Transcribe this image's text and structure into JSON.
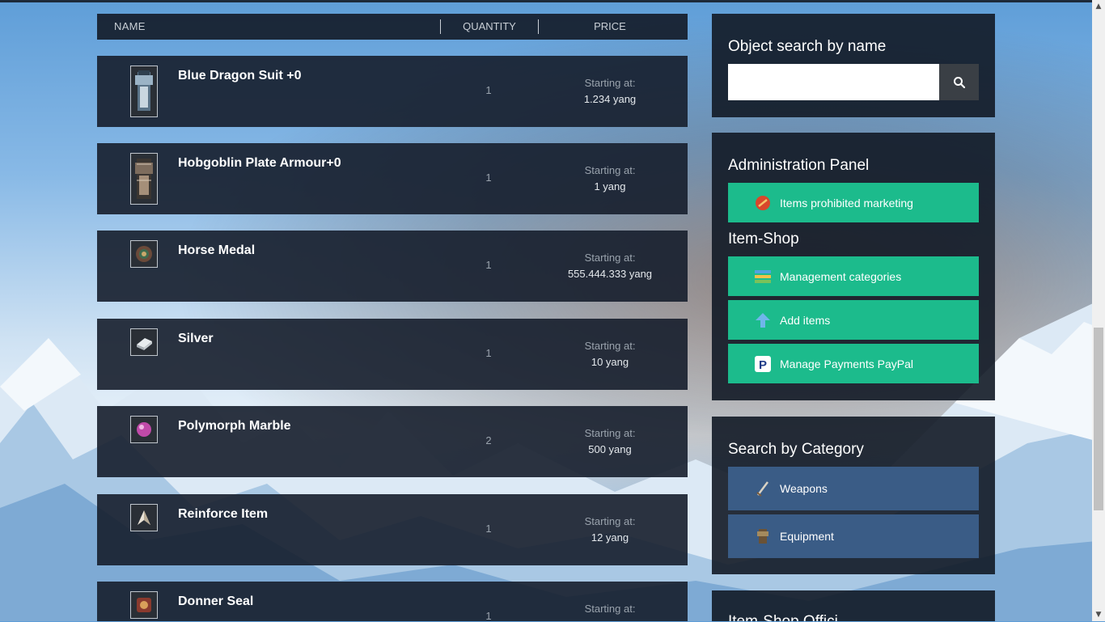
{
  "list_header": {
    "name": "NAME",
    "quantity": "QUANTITY",
    "price": "PRICE"
  },
  "items": [
    {
      "name": "Blue Dragon Suit +0",
      "quantity": "1",
      "price_label": "Starting at:",
      "price": "1.234 yang",
      "icon": "armor-suit-icon"
    },
    {
      "name": "Hobgoblin Plate Armour+0",
      "quantity": "1",
      "price_label": "Starting at:",
      "price": "1 yang",
      "icon": "plate-armor-icon"
    },
    {
      "name": "Horse Medal",
      "quantity": "1",
      "price_label": "Starting at:",
      "price": "555.444.333 yang",
      "icon": "medal-icon"
    },
    {
      "name": "Silver",
      "quantity": "1",
      "price_label": "Starting at:",
      "price": "10 yang",
      "icon": "silver-ingot-icon"
    },
    {
      "name": "Polymorph Marble",
      "quantity": "2",
      "price_label": "Starting at:",
      "price": "500 yang",
      "icon": "marble-icon"
    },
    {
      "name": "Reinforce Item",
      "quantity": "1",
      "price_label": "Starting at:",
      "price": "12 yang",
      "icon": "reinforce-icon"
    },
    {
      "name": "Donner Seal",
      "quantity": "1",
      "price_label": "Starting at:",
      "price": "",
      "icon": "seal-icon"
    }
  ],
  "search": {
    "title": "Object search by name",
    "placeholder": ""
  },
  "admin": {
    "title": "Administration Panel",
    "prohibited_label": "Items prohibited marketing",
    "itemshop_title": "Item-Shop",
    "management_label": "Management categories",
    "add_items_label": "Add items",
    "paypal_label": "Manage Payments PayPal"
  },
  "category": {
    "title": "Search by Category",
    "weapons_label": "Weapons",
    "equipment_label": "Equipment"
  },
  "bottom_panel": {
    "title_partial": "Item-Shop Offici..."
  },
  "colors": {
    "green": "#1cbb8c",
    "blue": "#3a5c86",
    "panel": "#121a26"
  }
}
